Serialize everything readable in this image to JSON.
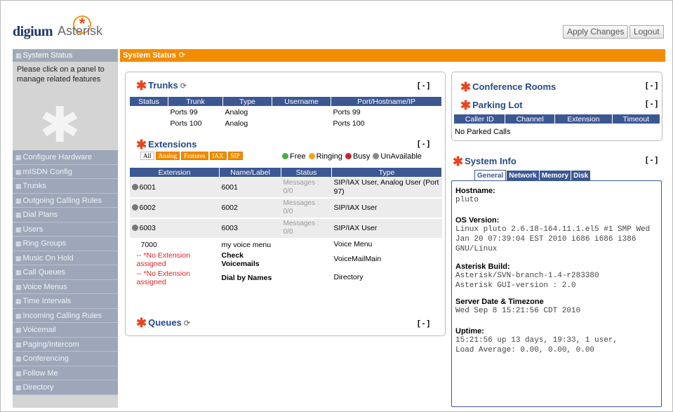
{
  "header": {
    "logo_left": "digium",
    "logo_right": "Asterisk",
    "apply_label": "Apply Changes",
    "logout_label": "Logout"
  },
  "sidebar": {
    "active_label": "System Status",
    "help_text": "Please click on a panel to manage related features",
    "items": [
      {
        "label": "Configure Hardware"
      },
      {
        "label": "mISDN Config"
      },
      {
        "label": "Trunks"
      },
      {
        "label": "Outgoing Calling Rules"
      },
      {
        "label": "Dial Plans"
      },
      {
        "label": "Users"
      },
      {
        "label": "Ring Groups"
      },
      {
        "label": "Music On Hold"
      },
      {
        "label": "Call Queues"
      },
      {
        "label": "Voice Menus"
      },
      {
        "label": "Time Intervals"
      },
      {
        "label": "Incoming Calling Rules"
      },
      {
        "label": "Voicemail"
      },
      {
        "label": "Paging/Intercom"
      },
      {
        "label": "Conferencing"
      },
      {
        "label": "Follow Me"
      },
      {
        "label": "Directory"
      }
    ]
  },
  "main": {
    "title": "System Status",
    "collapse_label": "[ - ]",
    "trunks": {
      "title": "Trunks",
      "headers": [
        "Status",
        "Trunk",
        "Type",
        "Username",
        "Port/Hostname/IP"
      ],
      "rows": [
        {
          "trunk": "Ports 99",
          "type": "Analog",
          "port": "Ports 99"
        },
        {
          "trunk": "Ports 100",
          "type": "Analog",
          "port": "Ports 100"
        }
      ]
    },
    "extensions": {
      "title": "Extensions",
      "filters": [
        "All",
        "Analog",
        "Features",
        "IAX",
        "SIP"
      ],
      "legend": {
        "free": "Free",
        "ringing": "Ringing",
        "busy": "Busy",
        "unavailable": "UnAvailable"
      },
      "headers": [
        "Extension",
        "Name/Label",
        "Status",
        "Type"
      ],
      "rows": [
        {
          "ext": "6001",
          "name": "6001",
          "status": "Messages : 0/0",
          "type": "SIP/IAX User, Analog User (Port 97)"
        },
        {
          "ext": "6002",
          "name": "6002",
          "status": "Messages : 0/0",
          "type": "SIP/IAX User"
        },
        {
          "ext": "6003",
          "name": "6003",
          "status": "Messages : 0/0",
          "type": "SIP/IAX User"
        },
        {
          "ext": "7000",
          "name": "my voice menu",
          "status": "",
          "type": "Voice Menu"
        },
        {
          "ext": "-- *No Extension assigned",
          "name": "Check Voicemails",
          "status": "",
          "type": "VoiceMailMain"
        },
        {
          "ext": "-- *No Extension assigned",
          "name": "Dial by Names",
          "status": "",
          "type": "Directory"
        }
      ]
    },
    "queues": {
      "title": "Queues"
    },
    "conference": {
      "title": "Conference Rooms"
    },
    "parking": {
      "title": "Parking Lot",
      "headers": [
        "Caller ID",
        "Channel",
        "Extension",
        "Timeout"
      ],
      "empty": "No Parked Calls"
    },
    "sysinfo": {
      "title": "System Info",
      "tabs": [
        "General",
        "Network",
        "Memory",
        "Disk"
      ],
      "hostname_label": "Hostname:",
      "hostname": "pluto",
      "os_label": "OS Version:",
      "os": "Linux pluto 2.6.18-164.11.1.el5 #1 SMP Wed Jan 20 07:39:04 EST 2010 i686 i686 i386 GNU/Linux",
      "build_label": "Asterisk Build:",
      "build1": "Asterisk/SVN-branch-1.4-r283380",
      "build2": "Asterisk GUI-version : 2.0",
      "date_label": "Server Date & Timezone",
      "date": "Wed Sep 8 15:21:56 CDT 2010",
      "uptime_label": "Uptime:",
      "uptime1": "15:21:56 up 13 days, 19:33, 1 user,",
      "uptime2": "Load Average: 0.00, 0.00, 0.00"
    }
  },
  "colors": {
    "accent": "#f28c00",
    "table_head": "#3c5893",
    "sidebar": "#9da7b9",
    "star": "#e8451e"
  },
  "icons": {
    "refresh": "refresh-icon",
    "star": "asterisk-star-icon",
    "grip": "grip-icon"
  }
}
